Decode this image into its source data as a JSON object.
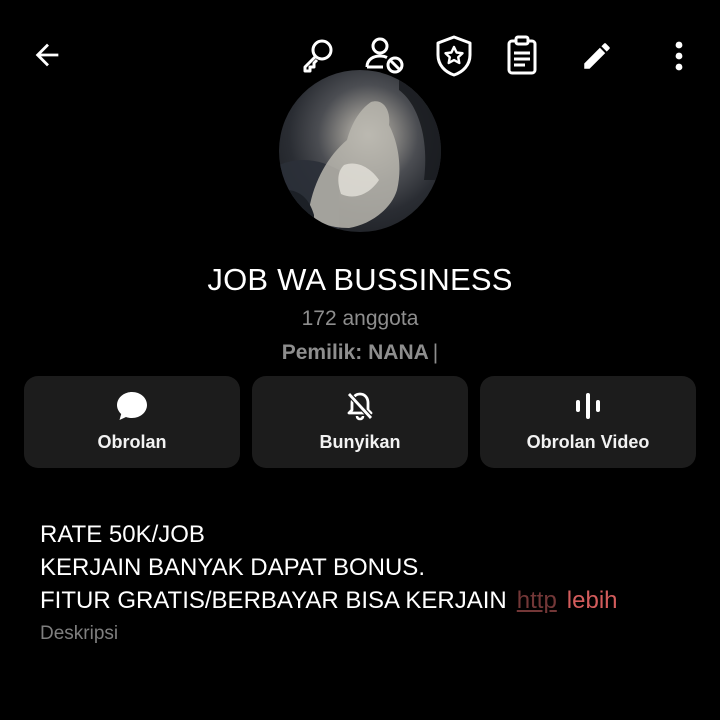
{
  "topbar": {
    "icons": [
      "back-arrow-icon",
      "key-icon",
      "person-block-icon",
      "shield-star-icon",
      "clipboard-icon",
      "pencil-icon",
      "more-vertical-icon"
    ]
  },
  "group": {
    "name": "JOB WA BUSSINESS",
    "members": "172 anggota",
    "owner": "Pemilik: NANA",
    "owner_cursor": "|"
  },
  "actions": [
    {
      "label": "Obrolan",
      "icon": "chat-bubble-icon"
    },
    {
      "label": "Bunyikan",
      "icon": "bell-off-icon"
    },
    {
      "label": "Obrolan Video",
      "icon": "audio-bars-icon"
    }
  ],
  "description": {
    "lines": [
      "RATE 50K/JOB",
      "KERJAIN BANYAK DAPAT BONUS.",
      "FITUR GRATIS/BERBAYAR BISA KERJAIN"
    ],
    "link_fragment": "http",
    "more_label": "lebih",
    "label": "Deskripsi"
  },
  "colors": {
    "background": "#000000",
    "card": "#1c1c1c",
    "muted_text": "#8e8e8e",
    "more_link": "#d35c5c"
  }
}
